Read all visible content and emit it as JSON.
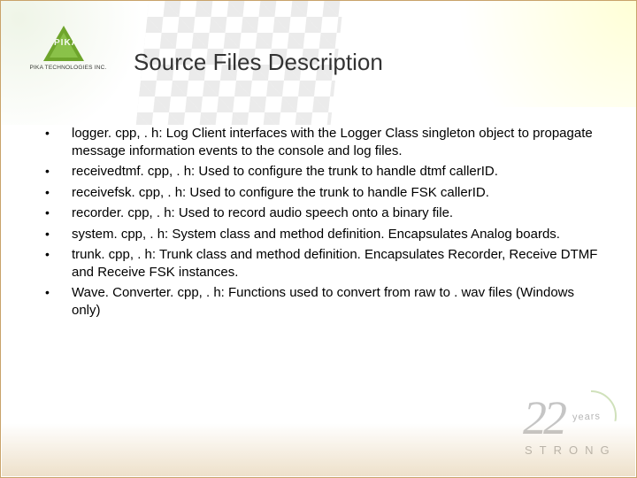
{
  "logo": {
    "mark_text": "PIKA",
    "subline": "PIKA TECHNOLOGIES INC."
  },
  "title": "Source Files Description",
  "bullets": [
    "logger. cpp, . h: Log Client interfaces with the Logger Class singleton object to propagate message information events to the console and log files.",
    "receivedtmf. cpp, . h: Used to configure the trunk to handle dtmf callerID.",
    "receivefsk. cpp, . h: Used to configure the trunk to handle FSK callerID.",
    "recorder. cpp, . h: Used to record audio speech onto a binary file.",
    "system. cpp, . h: System class and method definition.  Encapsulates Analog boards.",
    "trunk. cpp, . h: Trunk class and method definition. Encapsulates Recorder, Receive DTMF and Receive FSK instances.",
    "Wave. Converter. cpp, . h: Functions used to convert from raw to . wav files (Windows only)"
  ],
  "badge": {
    "number": "22",
    "years": "years",
    "strong": "STRONG"
  }
}
